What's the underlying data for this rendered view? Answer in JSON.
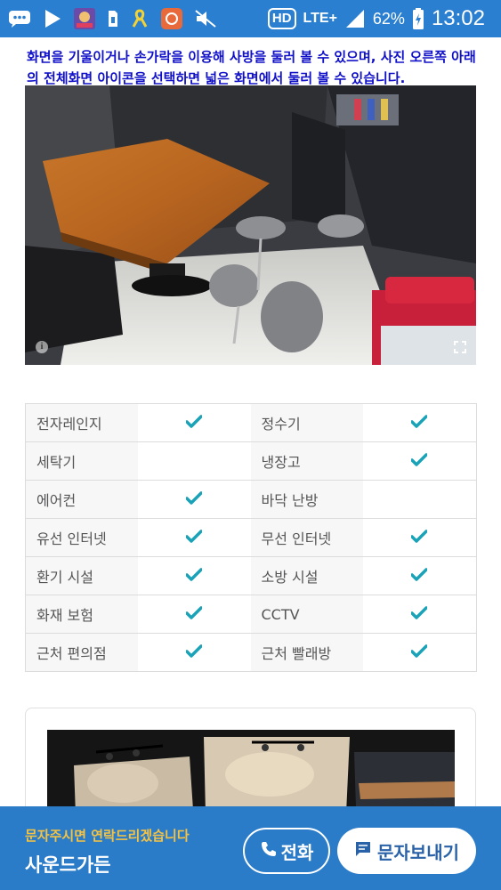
{
  "status_bar": {
    "icons": [
      "messages-icon",
      "play-store-icon",
      "game-app-icon",
      "sim-card-icon",
      "ribbon-icon",
      "app-icon",
      "mute-icon"
    ],
    "hd_label": "HD",
    "network_label": "LTE+",
    "battery_percent": "62%",
    "time": "13:02"
  },
  "description": "화면을 기울이거나 손가락을 이용해 사방을 둘러 볼 수 있으며, 사진 오른쪽 아래의 전체화면 아이콘을 선택하면 넓은 화면에서 둘러 볼 수 있습니다.",
  "amenities": [
    {
      "left": "전자레인지",
      "left_check": true,
      "right": "정수기",
      "right_check": true
    },
    {
      "left": "세탁기",
      "left_check": false,
      "right": "냉장고",
      "right_check": true
    },
    {
      "left": "에어컨",
      "left_check": true,
      "right": "바닥 난방",
      "right_check": false
    },
    {
      "left": "유선 인터넷",
      "left_check": true,
      "right": "무선 인터넷",
      "right_check": true
    },
    {
      "left": "환기 시설",
      "left_check": true,
      "right": "소방 시설",
      "right_check": true
    },
    {
      "left": "화재 보험",
      "left_check": true,
      "right": "CCTV",
      "right_check": true
    },
    {
      "left": "근처 편의점",
      "left_check": true,
      "right": "근처 빨래방",
      "right_check": true
    }
  ],
  "bottom_bar": {
    "subtitle": "문자주시면 연락드리겠습니다",
    "title": "사운드가든",
    "call_label": "전화",
    "sms_label": "문자보내기"
  },
  "colors": {
    "status_bar": "#2a7fd0",
    "description_text": "#1010c8",
    "check": "#1aa3b8",
    "bottom_bar": "#2a7cc9",
    "subtitle": "#f5c242"
  }
}
